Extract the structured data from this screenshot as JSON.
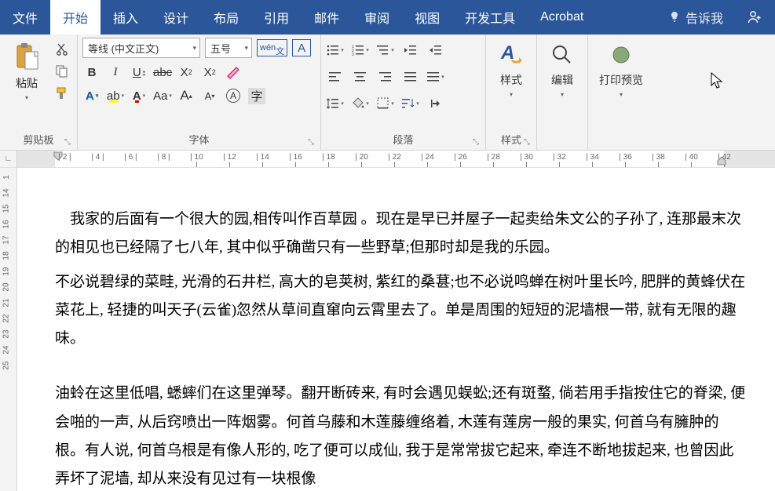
{
  "menu": {
    "tabs": [
      "文件",
      "开始",
      "插入",
      "设计",
      "布局",
      "引用",
      "邮件",
      "审阅",
      "视图",
      "开发工具",
      "Acrobat"
    ],
    "active_index": 1,
    "tell_me": "告诉我"
  },
  "ribbon": {
    "clipboard": {
      "paste": "粘贴",
      "label": "剪贴板"
    },
    "font": {
      "family": "等线 (中文正文)",
      "size": "五号",
      "ruby": "wén",
      "label": "字体",
      "accent_yellow": "#ffff00",
      "accent_red": "#d30000",
      "accent_blue": "#2b579a"
    },
    "paragraph": {
      "label": "段落"
    },
    "styles": {
      "btn": "样式",
      "label": "样式"
    },
    "editing": {
      "btn": "编辑"
    },
    "print_preview": {
      "btn": "打印预览"
    }
  },
  "ruler": {
    "h_ticks": [
      "2",
      "4",
      "6",
      "8",
      "10",
      "12",
      "14",
      "16",
      "18",
      "20",
      "22",
      "24",
      "26",
      "28",
      "30",
      "32",
      "34",
      "36",
      "38",
      "40",
      "42"
    ],
    "v_ticks": [
      "1",
      "14",
      "15",
      "16",
      "17",
      "18",
      "19",
      "20",
      "21",
      "22",
      "23",
      "24",
      "25"
    ]
  },
  "document": {
    "paragraphs": [
      "我家的后面有一个很大的园,相传叫作百草园 。现在是早已并屋子一起卖给朱文公的子孙了, 连那最末次的相见也已经隔了七八年, 其中似乎确凿只有一些野草;但那时却是我的乐园。",
      "不必说碧绿的菜畦, 光滑的石井栏, 高大的皂荚树, 紫红的桑葚;也不必说鸣蝉在树叶里长吟, 肥胖的黄蜂伏在菜花上, 轻捷的叫天子(云雀)忽然从草间直窜向云霄里去了。单是周围的短短的泥墙根一带, 就有无限的趣味。",
      "油蛉在这里低唱, 蟋蟀们在这里弹琴。翻开断砖来, 有时会遇见蜈蚣;还有斑蝥, 倘若用手指按住它的脊梁, 便会啪的一声, 从后窍喷出一阵烟雾。何首乌藤和木莲藤缠络着, 木莲有莲房一般的果实, 何首乌有臃肿的根。有人说, 何首乌根是有像人形的, 吃了便可以成仙, 我于是常常拔它起来, 牵连不断地拔起来, 也曾因此弄坏了泥墙, 却从来没有见过有一块根像"
    ]
  }
}
